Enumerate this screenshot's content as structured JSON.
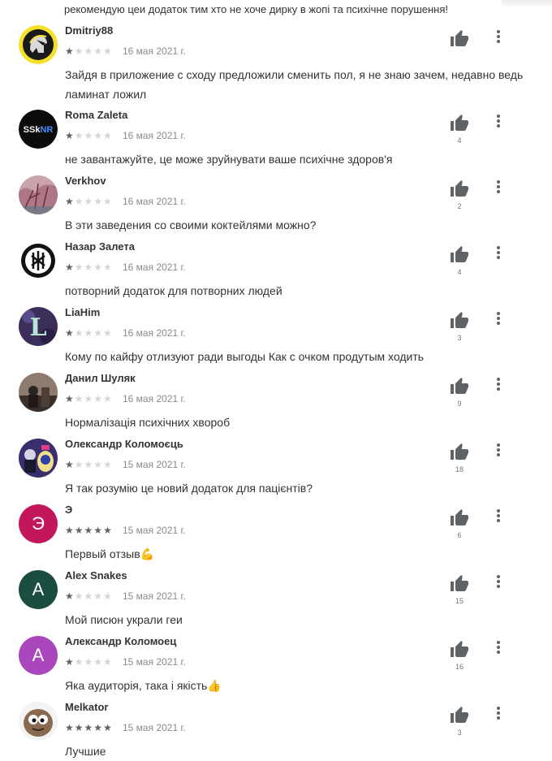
{
  "partial_review_text": "рекомендую цеи додаток тим хто не хоче дирку в жопі та психічне порушення!",
  "reviews": [
    {
      "author": "Dmitriy88",
      "rating": 1,
      "date": "16 мая 2021 г.",
      "text": "Зайдя в приложение с сходу предложили сменить пол, я не знаю зачем, недавно ведь ламинат ложил",
      "likes": "",
      "avatar": "spartan-helmet-avatar"
    },
    {
      "author": "Roma Zaleta",
      "rating": 1,
      "date": "16 мая 2021 г.",
      "text": "не завантажуйте, це може зруйнувати ваше психічне здоров'я",
      "likes": "4",
      "avatar": "ssknr-logo-avatar"
    },
    {
      "author": "Verkhov",
      "rating": 1,
      "date": "16 мая 2021 г.",
      "text": "В эти заведения со своими коктейлями можно?",
      "likes": "2",
      "avatar": "pink-tree-avatar"
    },
    {
      "author": "Назар Залета",
      "rating": 1,
      "date": "16 мая 2021 г.",
      "text": "потворний додаток для потворних людей",
      "likes": "4",
      "avatar": "emblem-avatar"
    },
    {
      "author": "LiaHim",
      "rating": 1,
      "date": "16 мая 2021 г.",
      "text": "Кому по кайфу отлизуют ради выгоды Как с очком продутым ходить",
      "likes": "3",
      "avatar": "letter-l-avatar",
      "avatar_letter": "L"
    },
    {
      "author": "Данил Шуляк",
      "rating": 1,
      "date": "16 мая 2021 г.",
      "text": "Нормалізація психічних хвороб",
      "likes": "9",
      "avatar": "photo-avatar"
    },
    {
      "author": "Олександр Коломоєць",
      "rating": 1,
      "date": "15 мая 2021 г.",
      "text": "Я так розумію це новий додаток для пацієнтів?",
      "likes": "18",
      "avatar": "group-photo-avatar"
    },
    {
      "author": "Э",
      "rating": 5,
      "date": "15 мая 2021 г.",
      "text": "Первый отзыв💪",
      "likes": "6",
      "avatar": "letter-avatar",
      "avatar_letter": "Э",
      "avatar_color": "#c2185b"
    },
    {
      "author": "Alex Snakes",
      "rating": 1,
      "date": "15 мая 2021 г.",
      "text": "Мой писюн украли геи",
      "likes": "15",
      "avatar": "letter-avatar",
      "avatar_letter": "A",
      "avatar_color": "#1b4d40"
    },
    {
      "author": "Александр Коломоец",
      "rating": 1,
      "date": "15 мая 2021 г.",
      "text": "Яка аудиторія, така і якість👍",
      "likes": "16",
      "avatar": "letter-avatar",
      "avatar_letter": "A",
      "avatar_color": "#ab47bc"
    },
    {
      "author": "Melkator",
      "rating": 5,
      "date": "15 мая 2021 г.",
      "text": "Лучшие",
      "likes": "3",
      "avatar": "cartoon-potato-avatar"
    }
  ],
  "colors": {
    "star_filled": "#5f6368",
    "star_empty": "#d5d5d5",
    "icon": "#5f6368"
  }
}
